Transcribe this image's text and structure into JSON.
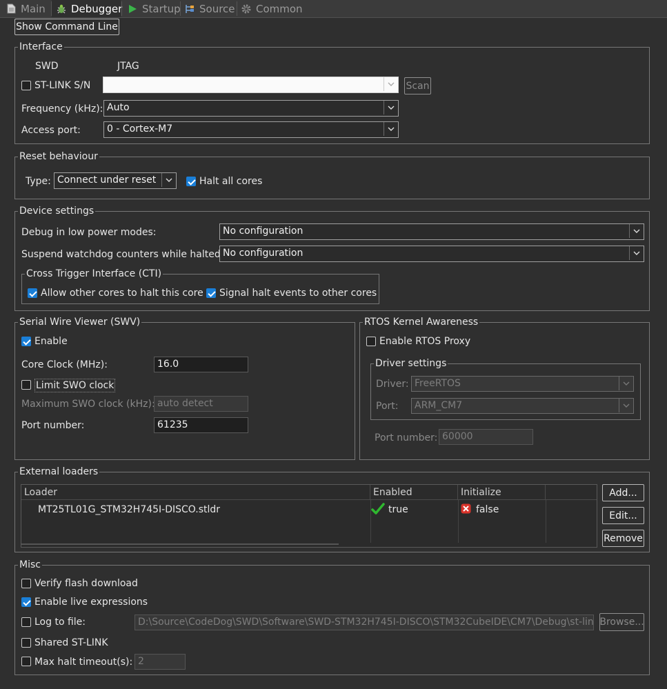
{
  "tabs": [
    {
      "label": "Main",
      "icon": "document-icon",
      "active": false
    },
    {
      "label": "Debugger",
      "icon": "bug-icon",
      "active": true
    },
    {
      "label": "Startup",
      "icon": "play-icon",
      "active": false
    },
    {
      "label": "Source",
      "icon": "source-icon",
      "active": false
    },
    {
      "label": "Common",
      "icon": "gear-icon",
      "active": false
    }
  ],
  "show_command_line": "Show Command Line",
  "interface": {
    "title": "Interface",
    "swd": "SWD",
    "jtag": "JTAG",
    "stlink_sn_label": "ST-LINK S/N",
    "stlink_sn_value": "",
    "scan": "Scan",
    "frequency_label": "Frequency (kHz):",
    "frequency_value": "Auto",
    "access_port_label": "Access port:",
    "access_port_value": "0 - Cortex-M7"
  },
  "reset": {
    "title": "Reset behaviour",
    "type_label": "Type:",
    "type_value": "Connect under reset",
    "halt_all_cores": "Halt all cores"
  },
  "device": {
    "title": "Device settings",
    "low_power_label": "Debug in low power modes:",
    "low_power_value": "No configuration",
    "watchdog_label": "Suspend watchdog counters while halted:",
    "watchdog_value": "No configuration",
    "cti_title": "Cross Trigger Interface (CTI)",
    "cti_allow": "Allow other cores to halt this core",
    "cti_signal": "Signal halt events to other cores"
  },
  "swv": {
    "title": "Serial Wire Viewer (SWV)",
    "enable": "Enable",
    "core_clock_label": "Core Clock (MHz):",
    "core_clock_value": "16.0",
    "limit_swo": "Limit SWO clock",
    "max_swo_label": "Maximum SWO clock (kHz):",
    "max_swo_value": "auto detect",
    "port_label": "Port number:",
    "port_value": "61235"
  },
  "rtos": {
    "title": "RTOS Kernel Awareness",
    "enable_proxy": "Enable RTOS Proxy",
    "driver_settings": "Driver settings",
    "driver_label": "Driver:",
    "driver_value": "FreeRTOS",
    "port_label": "Port:",
    "port_value": "ARM_CM7",
    "port_number_label": "Port number:",
    "port_number_value": "60000"
  },
  "loaders": {
    "title": "External loaders",
    "columns": [
      "Loader",
      "Enabled",
      "Initialize"
    ],
    "rows": [
      {
        "loader": "MT25TL01G_STM32H745I-DISCO.stldr",
        "enabled": "true",
        "initialize": "false"
      }
    ],
    "add": "Add...",
    "edit": "Edit...",
    "remove": "Remove"
  },
  "misc": {
    "title": "Misc",
    "verify_flash": "Verify flash download",
    "live_expr": "Enable live expressions",
    "log_to_file": "Log to file:",
    "log_path": "D:\\Source\\CodeDog\\SWD\\Software\\SWD-STM32H745I-DISCO\\STM32CubeIDE\\CM7\\Debug\\st-link_gdbserver_log.txt",
    "browse": "Browse...",
    "shared_stlink": "Shared ST-LINK",
    "max_halt": "Max halt timeout(s):",
    "max_halt_value": "2"
  },
  "colors": {
    "background": "#2f2f2f",
    "checkbox_checked": "#1a7fd8",
    "true_check": "#2fb82f",
    "false_x": "#d9342b"
  }
}
